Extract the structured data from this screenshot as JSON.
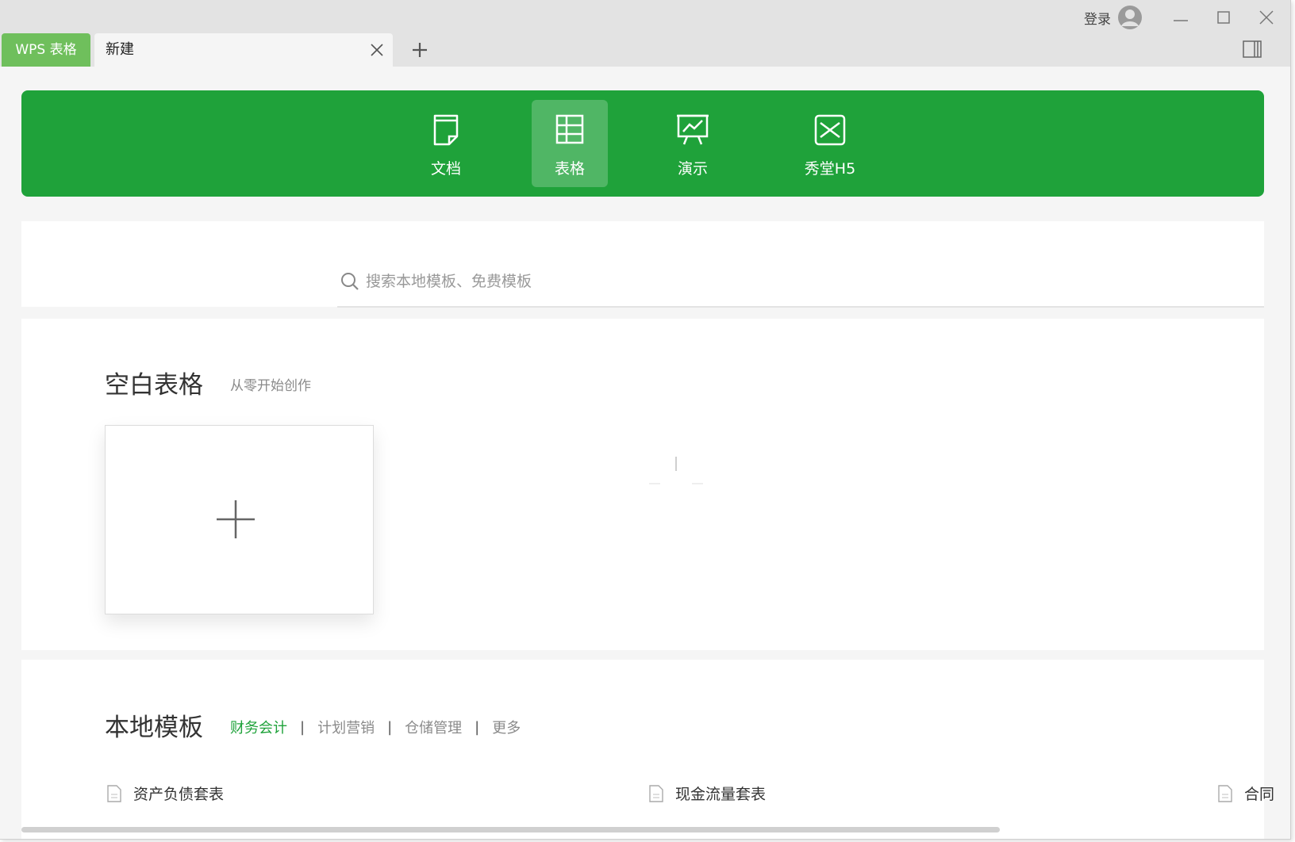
{
  "titlebar": {
    "app_tab": "WPS 表格",
    "doc_tab": "新建",
    "login": "登录"
  },
  "categories": [
    {
      "label": "文档",
      "icon": "document-icon"
    },
    {
      "label": "表格",
      "icon": "spreadsheet-icon",
      "active": true
    },
    {
      "label": "演示",
      "icon": "presentation-icon"
    },
    {
      "label": "秀堂H5",
      "icon": "h5-icon"
    }
  ],
  "search": {
    "placeholder": "搜索本地模板、免费模板"
  },
  "blank": {
    "title": "空白表格",
    "subtitle": "从零开始创作"
  },
  "templates": {
    "title": "本地模板",
    "filters": [
      "财务会计",
      "计划营销",
      "仓储管理",
      "更多"
    ],
    "active_filter": "财务会计",
    "items": [
      "资产负债套表",
      "现金流量套表",
      "合同"
    ]
  },
  "colors": {
    "accent": "#1fa23a",
    "app_tab": "#6fbf5c"
  }
}
